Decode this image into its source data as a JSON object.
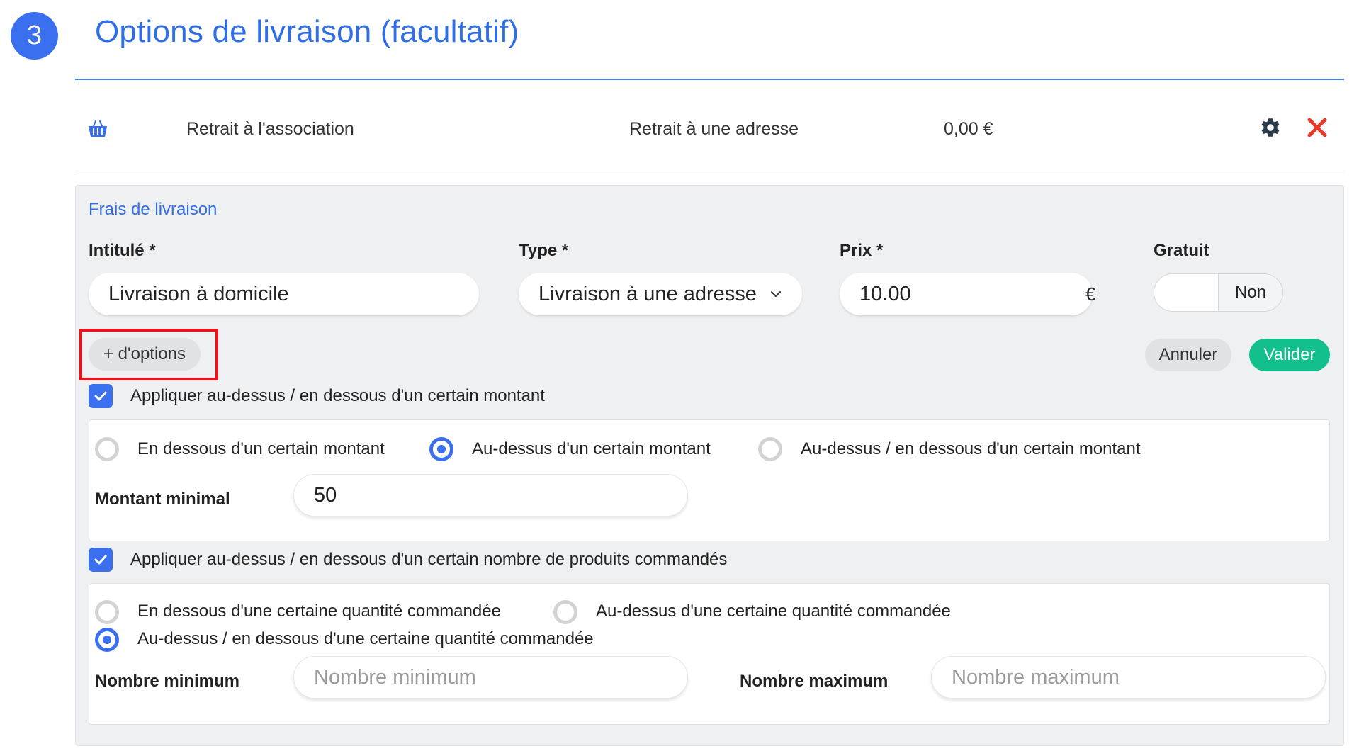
{
  "step": {
    "number": "3",
    "title": "Options de livraison (facultatif)"
  },
  "existing_option": {
    "icon": "basket-icon",
    "name": "Retrait à l'association",
    "type": "Retrait à une adresse",
    "price": "0,00 €"
  },
  "form": {
    "section_title": "Frais de livraison",
    "label_field": {
      "label": "Intitulé *",
      "value": "Livraison à domicile"
    },
    "type_field": {
      "label": "Type *",
      "value": "Livraison à une adresse"
    },
    "price_field": {
      "label": "Prix *",
      "value": "10.00",
      "currency": "€"
    },
    "free_field": {
      "label": "Gratuit",
      "value": "Non"
    },
    "more_options_label": "+ d'options",
    "cancel_label": "Annuler",
    "validate_label": "Valider",
    "amount_section": {
      "checkbox_label": "Appliquer au-dessus / en dessous d'un certain montant",
      "checked": true,
      "options": [
        "En dessous d'un certain montant",
        "Au-dessus d'un certain montant",
        "Au-dessus / en dessous d'un certain montant"
      ],
      "selected_option": "Au-dessus d'un certain montant",
      "min_label": "Montant minimal",
      "min_value": "50"
    },
    "quantity_section": {
      "checkbox_label": "Appliquer au-dessus / en dessous d'un certain nombre de produits commandés",
      "checked": true,
      "options": [
        "En dessous d'une certaine quantité commandée",
        "Au-dessus d'une certaine quantité commandée",
        "Au-dessus / en dessous d'une certaine quantité commandée"
      ],
      "selected_option": "Au-dessus / en dessous d'une certaine quantité commandée",
      "min_label": "Nombre minimum",
      "min_placeholder": "Nombre minimum",
      "max_label": "Nombre maximum",
      "max_placeholder": "Nombre maximum"
    }
  },
  "colors": {
    "accent_blue": "#3a70f0",
    "title_blue": "#2f6ee6",
    "validate_green": "#11c08c",
    "delete_red": "#e8382a",
    "highlight_red": "#e8141b"
  }
}
